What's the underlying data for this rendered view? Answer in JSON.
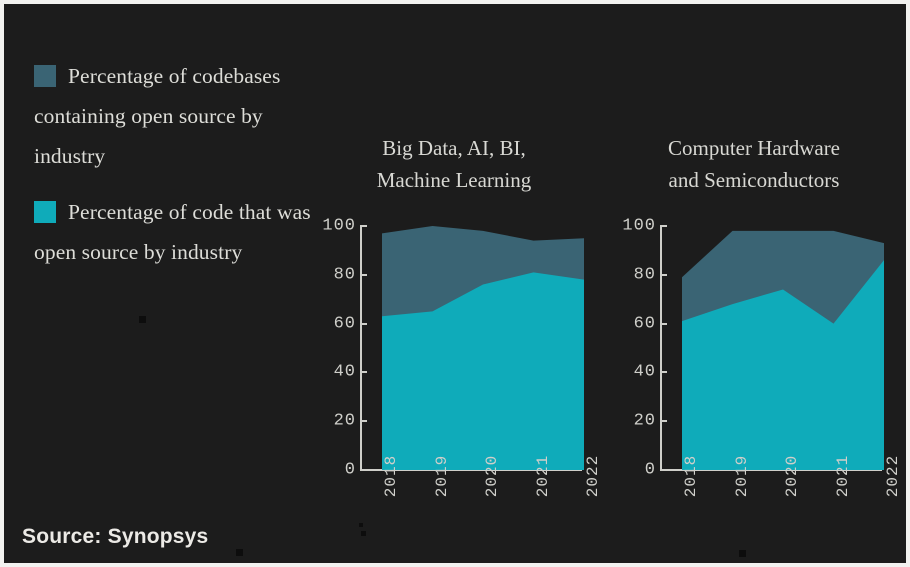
{
  "slide": {
    "background_color": "#1c1c1c",
    "border_color": "#f2f2f0",
    "source_label": "Source: Synopsys"
  },
  "legend": {
    "items": [
      {
        "swatch_color": "#3a6474",
        "label": "Percentage of codebases containing open source by industry"
      },
      {
        "swatch_color": "#0fabba",
        "label": "Percentage of code that was open source by industry"
      }
    ]
  },
  "chart_data": [
    {
      "type": "area",
      "title": "Big Data, AI, BI,\nMachine Learning",
      "xlabel": "",
      "ylabel": "",
      "categories": [
        "2018",
        "2019",
        "2020",
        "2021",
        "2022"
      ],
      "ylim": [
        0,
        100
      ],
      "yticks": [
        0,
        20,
        40,
        60,
        80,
        100
      ],
      "ytick_labels": [
        "0",
        "20",
        "40",
        "60",
        "80",
        "100"
      ],
      "grid": false,
      "legend_position": "left-external",
      "stacked": true,
      "series": [
        {
          "name": "Percentage of code that was open source by industry",
          "color": "#0fabba",
          "values": [
            63,
            65,
            76,
            81,
            78
          ]
        },
        {
          "name": "Percentage of codebases containing open source by industry",
          "color": "#3a6474",
          "values": [
            97,
            100,
            98,
            94,
            95
          ]
        }
      ]
    },
    {
      "type": "area",
      "title": "Computer Hardware\nand Semiconductors",
      "xlabel": "",
      "ylabel": "",
      "categories": [
        "2018",
        "2019",
        "2020",
        "2021",
        "2022"
      ],
      "ylim": [
        0,
        100
      ],
      "yticks": [
        0,
        20,
        40,
        60,
        80,
        100
      ],
      "ytick_labels": [
        "0",
        "20",
        "40",
        "60",
        "80",
        "100"
      ],
      "grid": false,
      "legend_position": "left-external",
      "stacked": true,
      "series": [
        {
          "name": "Percentage of code that was open source by industry",
          "color": "#0fabba",
          "values": [
            61,
            68,
            74,
            60,
            86
          ]
        },
        {
          "name": "Percentage of codebases containing open source by industry",
          "color": "#3a6474",
          "values": [
            79,
            98,
            98,
            98,
            93
          ]
        }
      ]
    }
  ]
}
